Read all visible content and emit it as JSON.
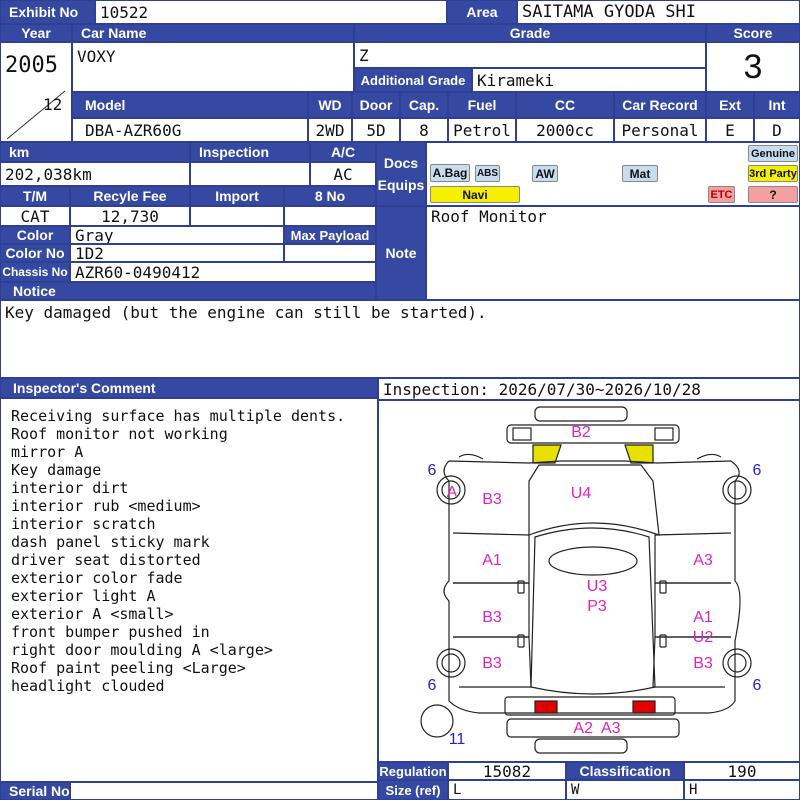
{
  "header": {
    "exhibit_no_label": "Exhibit No",
    "exhibit_no": "10522",
    "area_label": "Area",
    "area": "SAITAMA GYODA SHI"
  },
  "vehicle": {
    "year_label": "Year",
    "year": "2005",
    "month": "12",
    "car_name_label": "Car Name",
    "car_name": "VOXY",
    "grade_label": "Grade",
    "grade": "Z",
    "additional_grade_label": "Additional Grade",
    "additional_grade": "Kirameki",
    "score_label": "Score",
    "score": "3",
    "model_label": "Model",
    "model": "DBA-AZR60G",
    "wd_label": "WD",
    "wd": "2WD",
    "door_label": "Door",
    "door": "5D",
    "cap_label": "Cap.",
    "cap": "8",
    "fuel_label": "Fuel",
    "fuel": "Petrol",
    "cc_label": "CC",
    "cc": "2000cc",
    "car_record_label": "Car Record",
    "car_record": "Personal",
    "ext_label": "Ext",
    "ext": "E",
    "int_label": "Int",
    "int": "D"
  },
  "details": {
    "km_label": "km",
    "km": "202,038km",
    "inspection_label": "Inspection",
    "inspection": "",
    "ac_label": "A/C",
    "ac": "AC",
    "tm_label": "T/M",
    "tm": "CAT",
    "recycle_fee_label": "Recyle Fee",
    "recycle_fee": "12,730",
    "import_label": "Import",
    "no8_label": "8 No",
    "color_label": "Color",
    "color": "Gray",
    "max_payload_label": "Max Payload",
    "color_no_label": "Color No",
    "color_no": "1D2",
    "chassis_no_label": "Chassis No",
    "chassis_no": "AZR60-0490412",
    "notice_label": "Notice",
    "notice": "Key damaged (but the engine can still be started)."
  },
  "equips": {
    "docs_label": "Docs",
    "equips_label": "Equips",
    "abag": "A.Bag",
    "abs": "ABS",
    "aw": "AW",
    "mat": "Mat",
    "genuine": "Genuine",
    "third_party": "3rd Party",
    "navi": "Navi",
    "etc": "ETC",
    "question": "?",
    "colors": {
      "navi": "#f5f000",
      "third_party": "#f5f000",
      "etc": "#f4a0a0",
      "question": "#f4a0a0",
      "tag": "#c8dcf0"
    }
  },
  "note": {
    "label": "Note",
    "text": "Roof Monitor"
  },
  "inspector": {
    "label": "Inspector's Comment",
    "period": "Inspection: 2026/07/30~2026/10/28",
    "comments": [
      "Receiving surface has multiple dents.",
      "Roof monitor not working",
      "mirror A",
      "Key damage",
      "interior dirt",
      "interior rub <medium>",
      "interior scratch",
      "dash panel sticky mark",
      "driver seat distorted",
      "exterior color fade",
      "exterior light A",
      "exterior A <small>",
      "front bumper pushed in",
      "right door moulding A <large>",
      "Roof paint peeling <Large>",
      "headlight clouded"
    ]
  },
  "diagram": {
    "b2": "B2",
    "u4": "U4",
    "b3_a": "B3",
    "a_mirror": "A",
    "a1_left": "A1",
    "a3_right": "A3",
    "b3_b": "B3",
    "u3": "U3",
    "p3": "P3",
    "a1_right": "A1",
    "u2": "U2",
    "b3_c": "B3",
    "b3_d": "B3",
    "a2_a3": "A2  A3",
    "tire_tl": "6",
    "tire_tr": "6",
    "tire_bl": "6",
    "tire_br": "6",
    "spare": "11"
  },
  "footer": {
    "regulation_label": "Regulation",
    "regulation": "15082",
    "classification_label": "Classification",
    "classification": "190",
    "size_label": "Size (ref)",
    "size_l": "L",
    "size_w": "W",
    "size_h": "H",
    "serial_no_label": "Serial No"
  }
}
